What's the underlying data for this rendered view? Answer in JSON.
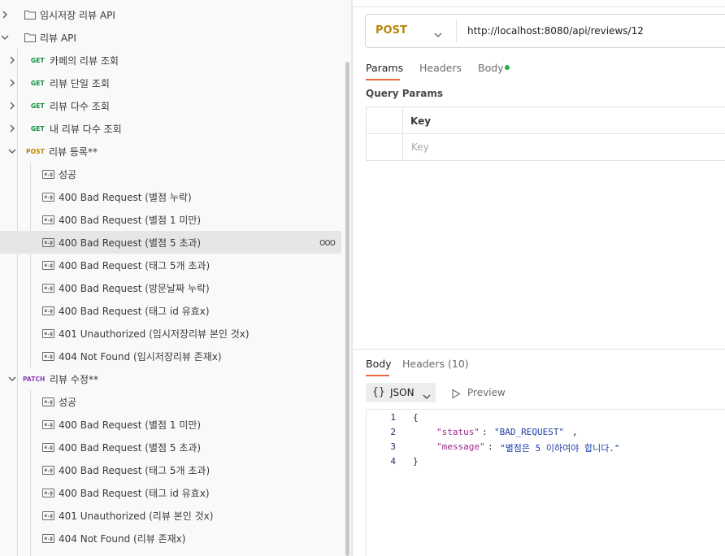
{
  "sidebar": {
    "collections": [
      {
        "label": "임시저장 리뷰 API"
      },
      {
        "label": "리뷰 API"
      }
    ],
    "requests": [
      {
        "method": "GET",
        "label": "카페의 리뷰 조회"
      },
      {
        "method": "GET",
        "label": "리뷰 단일 조회"
      },
      {
        "method": "GET",
        "label": "리뷰 다수 조회"
      },
      {
        "method": "GET",
        "label": "내 리뷰 다수 조회"
      },
      {
        "method": "POST",
        "label": "리뷰 등록**"
      },
      {
        "method": "PATCH",
        "label": "리뷰 수정**"
      }
    ],
    "post_examples": [
      "성공",
      "400 Bad Request (별점 누락)",
      "400 Bad Request (별점 1 미만)",
      "400 Bad Request (별점 5 초과)",
      "400 Bad Request (태그 5개 초과)",
      "400 Bad Request (방문날짜 누락)",
      "400 Bad Request (태그 id 유효x)",
      "401 Unauthorized (임시저장리뷰 본인 것x)",
      "404 Not Found (임시저장리뷰 존재x)"
    ],
    "patch_examples": [
      "성공",
      "400 Bad Request (별점 1 미만)",
      "400 Bad Request (별점 5 초과)",
      "400 Bad Request (태그 5개 초과)",
      "400 Bad Request (태그 id 유효x)",
      "401 Unauthorized (리뷰 본인 것x)",
      "404 Not Found (리뷰 존재x)"
    ],
    "more_actions": "ooo",
    "example_icon_text": "e.g"
  },
  "request": {
    "method": "POST",
    "url": "http://localhost:8080/api/reviews/12",
    "tabs": [
      "Params",
      "Headers",
      "Body"
    ],
    "active_tab": "Params",
    "query_params_title": "Query Params",
    "key_header": "Key",
    "key_placeholder": "Key"
  },
  "response": {
    "tabs": [
      "Body",
      "Headers (10)"
    ],
    "active_tab": "Body",
    "format_braces": "{}",
    "format": "JSON",
    "preview_label": "Preview",
    "line_numbers": [
      "1",
      "2",
      "3",
      "4"
    ],
    "json": {
      "open": "{",
      "close": "}",
      "status_key": "\"status\"",
      "status_value": "\"BAD_REQUEST\"",
      "message_key": "\"message\"",
      "message_value": "\"별점은 5 이하여야 합니다.\""
    }
  },
  "colors": {
    "get": "#0f8a3c",
    "post": "#b8860b",
    "patch": "#8a3fb0",
    "accent": "#e46a3b",
    "body_dot": "#21b24b"
  }
}
